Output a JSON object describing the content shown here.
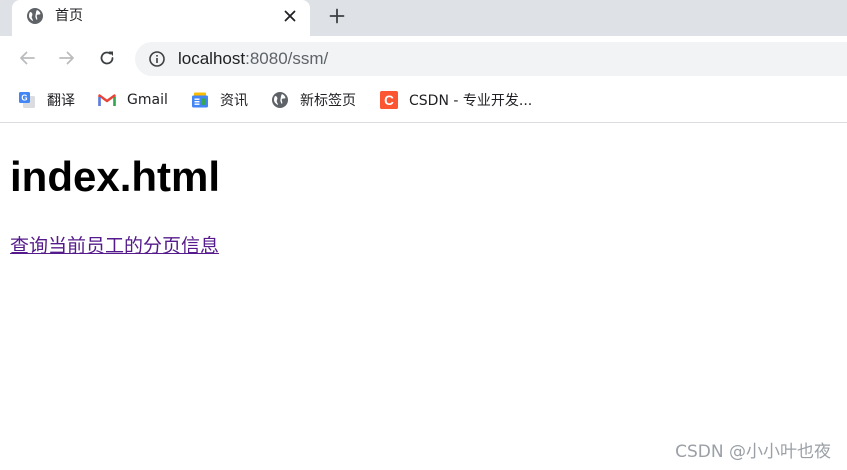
{
  "tab": {
    "title": "首页",
    "favicon": "globe-icon",
    "close_icon": "close-icon",
    "new_tab_icon": "plus-icon"
  },
  "toolbar": {
    "back_icon": "arrow-left-icon",
    "forward_icon": "arrow-right-icon",
    "reload_icon": "reload-icon",
    "info_icon": "info-icon",
    "url_host": "localhost",
    "url_rest": ":8080/ssm/"
  },
  "bookmarks": [
    {
      "label": "翻译",
      "icon": "google-translate-icon"
    },
    {
      "label": "Gmail",
      "icon": "gmail-icon"
    },
    {
      "label": "资讯",
      "icon": "google-news-icon"
    },
    {
      "label": "新标签页",
      "icon": "globe-icon"
    },
    {
      "label": "CSDN - 专业开发...",
      "icon": "csdn-icon"
    }
  ],
  "page": {
    "heading": "index.html",
    "link_text": "查询当前员工的分页信息",
    "watermark": "CSDN @小小叶也夜"
  },
  "colors": {
    "tabstrip_bg": "#dee1e6",
    "omnibox_bg": "#f1f3f4",
    "visited_link": "#551a8b",
    "csdn_brand": "#fc5531",
    "gmail_red": "#ea4335"
  }
}
